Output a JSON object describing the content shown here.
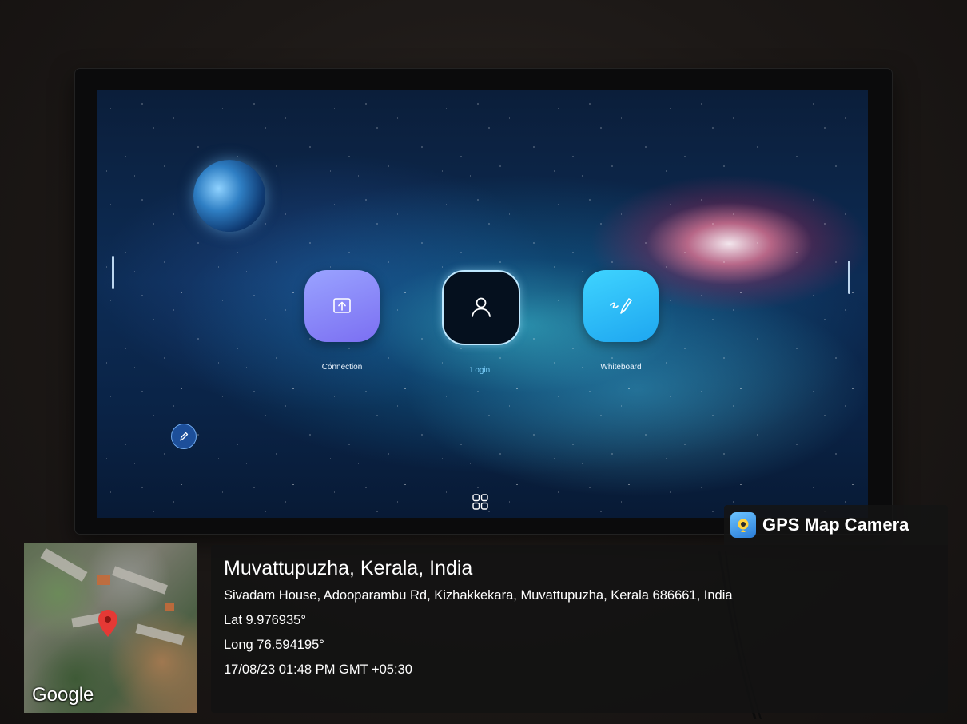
{
  "tv_screen": {
    "apps": [
      {
        "label": "Connection",
        "icon": "cast-screen-icon"
      },
      {
        "label": "Login",
        "icon": "user-icon"
      },
      {
        "label": "Whiteboard",
        "icon": "whiteboard-pen-icon"
      }
    ],
    "floating_button_icon": "pen-icon",
    "bottom_icon": "apps-grid-icon"
  },
  "gps_overlay": {
    "app_name": "GPS Map Camera",
    "place": "Muvattupuzha, Kerala, India",
    "address": "Sivadam House, Adooparambu Rd, Kizhakkekara, Muvattupuzha, Kerala 686661, India",
    "lat": "Lat 9.976935°",
    "long": "Long 76.594195°",
    "datetime": "17/08/23 01:48 PM GMT +05:30",
    "map_brand": "Google"
  },
  "colors": {
    "connection_tile": "#8a88f8",
    "login_label": "#7fd3ff",
    "whiteboard_tile": "#2fb8f6",
    "map_pin": "#e53935"
  }
}
